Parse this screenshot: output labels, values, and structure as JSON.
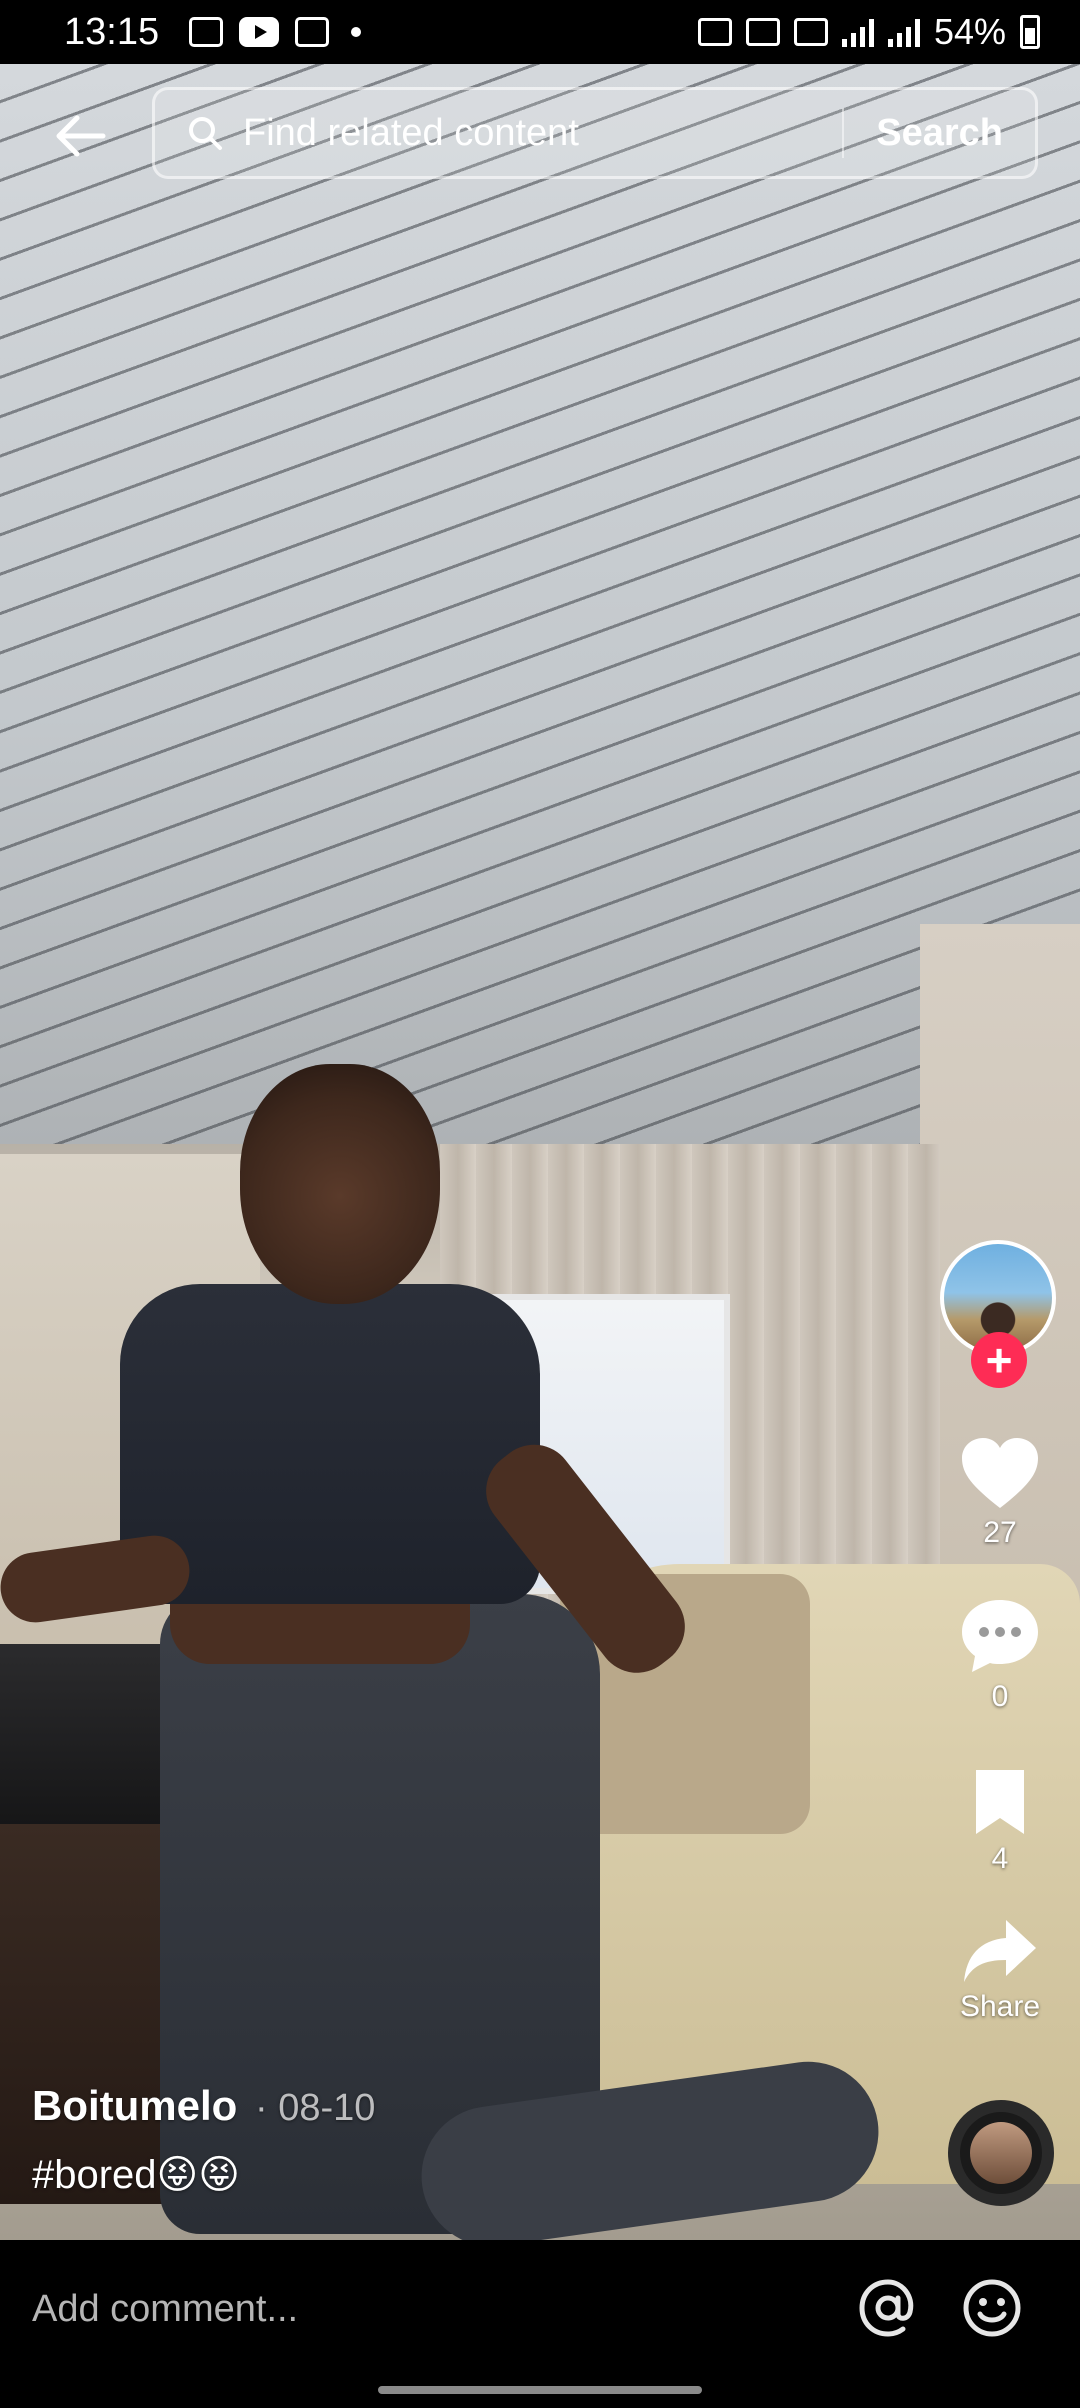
{
  "status_bar": {
    "time": "13:15",
    "battery": "54%"
  },
  "search": {
    "placeholder": "Find related content",
    "button_label": "Search"
  },
  "actions": {
    "like_count": "27",
    "comment_count": "0",
    "favorite_count": "4",
    "share_label": "Share"
  },
  "post": {
    "author": "Boitumelo",
    "date": "· 08-10",
    "caption": "#bored😝😝"
  },
  "comment": {
    "placeholder": "Add comment..."
  },
  "colors": {
    "follow_accent": "#fe2c55",
    "background": "#000000"
  }
}
